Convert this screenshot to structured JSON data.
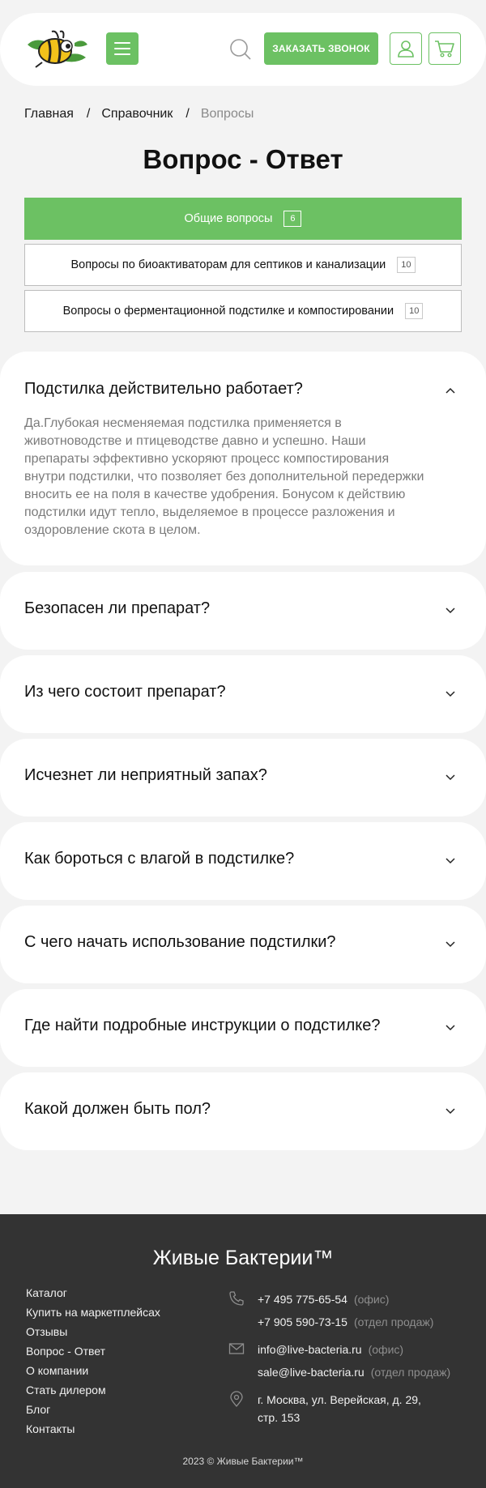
{
  "header": {
    "call_button": "ЗАКАЗАТЬ ЗВОНОК",
    "accent_color": "#6cc163"
  },
  "breadcrumb": {
    "home": "Главная",
    "section": "Справочник",
    "current": "Вопросы",
    "separator": "/"
  },
  "page_title": "Вопрос - Ответ",
  "tabs": [
    {
      "label": "Общие вопросы",
      "count": "6",
      "active": true
    },
    {
      "label": "Вопросы по биоактиваторам для септиков и канализации",
      "count": "10",
      "active": false
    },
    {
      "label": "Вопросы о ферментационной подстилке и компостировании",
      "count": "10",
      "active": false
    }
  ],
  "faq": [
    {
      "question": "Подстилка действительно работает?",
      "expanded": true,
      "answer_lines": [
        "Да.Глубокая несменяемая подстилка применяется в",
        "животноводстве и птицеводстве давно и успешно. Наши",
        "препараты эффективно ускоряют процесс компостирования",
        "внутри подстилки, что позволяет без дополнительной передержки",
        "вносить ее на поля в качестве удобрения. Бонусом к действию",
        "подстилки идут тепло, выделяемое в процессе разложения и",
        "оздоровление скота в целом."
      ]
    },
    {
      "question": "Безопасен ли препарат?",
      "expanded": false
    },
    {
      "question": "Из чего состоит препарат?",
      "expanded": false
    },
    {
      "question": "Исчезнет ли неприятный запах?",
      "expanded": false
    },
    {
      "question": "Как бороться с влагой в подстилке?",
      "expanded": false
    },
    {
      "question": "С чего начать использование подстилки?",
      "expanded": false
    },
    {
      "question": "Где найти подробные инструкции о подстилке?",
      "expanded": false
    },
    {
      "question": "Какой должен быть пол?",
      "expanded": false
    }
  ],
  "footer": {
    "brand": "Живые Бактерии™",
    "nav": [
      "Каталог",
      "Купить на маркетплейсах",
      "Отзывы",
      "Вопрос - Ответ",
      "О компании",
      "Стать дилером",
      "Блог",
      "Контакты"
    ],
    "phones": [
      {
        "value": "+7 495 775-65-54",
        "note": "(офис)"
      },
      {
        "value": "+7 905 590-73-15",
        "note": "(отдел продаж)"
      }
    ],
    "emails": [
      {
        "value": "info@live-bacteria.ru",
        "note": "(офис)"
      },
      {
        "value": "sale@live-bacteria.ru",
        "note": "(отдел продаж)"
      }
    ],
    "address": [
      "г. Москва, ул. Верейская, д. 29,",
      "стр. 153"
    ],
    "copyright": "2023 © Живые Бактерии™"
  }
}
